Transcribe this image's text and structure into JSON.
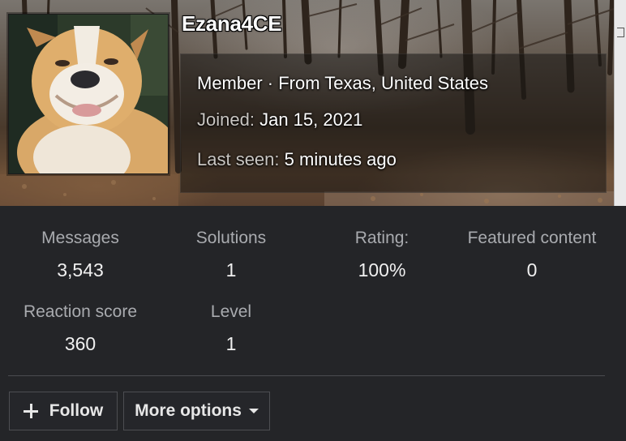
{
  "profile": {
    "username": "Ezana4CE",
    "avatar_icon": "bulldog-avatar-photo",
    "member_line": "Member · From Texas, United States",
    "joined_label": "Joined:",
    "joined_value": "Jan 15, 2021",
    "last_seen_label": "Last seen:",
    "last_seen_value": "5 minutes ago"
  },
  "stats": [
    {
      "label": "Messages",
      "value": "3,543"
    },
    {
      "label": "Solutions",
      "value": "1"
    },
    {
      "label": "Rating:",
      "value": "100%"
    },
    {
      "label": "Featured content",
      "value": "0"
    },
    {
      "label": "Reaction score",
      "value": "360"
    },
    {
      "label": "Level",
      "value": "1"
    }
  ],
  "actions": {
    "follow_label": "Follow",
    "follow_icon": "plus-icon",
    "more_options_label": "More options",
    "more_options_icon": "caret-down-icon"
  },
  "colors": {
    "background": "#242528",
    "label_gray": "#a9abaf",
    "divider": "#4a4b4f"
  }
}
